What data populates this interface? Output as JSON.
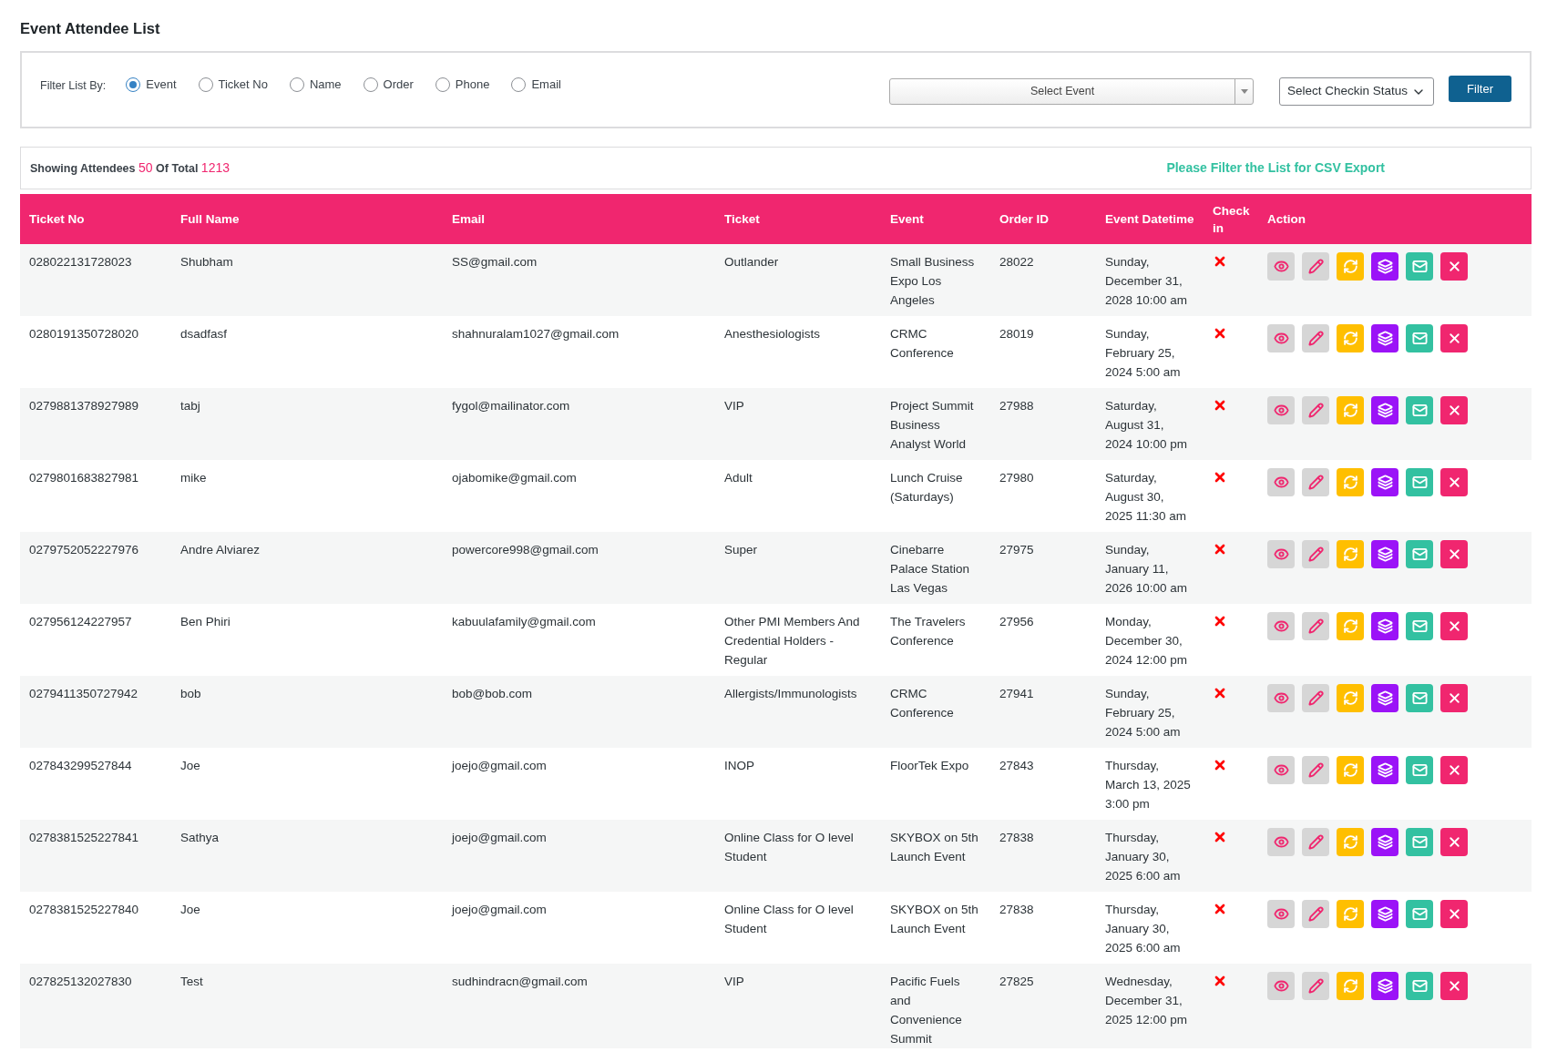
{
  "page_title": "Event Attendee List",
  "filter": {
    "label": "Filter List By:",
    "options": [
      {
        "label": "Event",
        "selected": true
      },
      {
        "label": "Ticket No",
        "selected": false
      },
      {
        "label": "Name",
        "selected": false
      },
      {
        "label": "Order",
        "selected": false
      },
      {
        "label": "Phone",
        "selected": false
      },
      {
        "label": "Email",
        "selected": false
      }
    ],
    "event_select": "Select Event",
    "status_select": "Select Checkin Status",
    "button": "Filter"
  },
  "summary": {
    "prefix": "Showing Attendees",
    "shown": "50",
    "middle": "Of Total",
    "total": "1213",
    "export_note": "Please Filter the List for CSV Export"
  },
  "table": {
    "columns": [
      "Ticket No",
      "Full Name",
      "Email",
      "Ticket",
      "Event",
      "Order ID",
      "Event Datetime",
      "Check in",
      "Action"
    ],
    "rows": [
      {
        "ticket_no": "028022131728023",
        "name": "Shubham",
        "email": "SS@gmail.com",
        "ticket": "Outlander",
        "event": "Small Business Expo Los Angeles",
        "order_id": "28022",
        "datetime": "Sunday, December 31, 2028 10:00 am",
        "checked_in": false
      },
      {
        "ticket_no": "0280191350728020",
        "name": "dsadfasf",
        "email": "shahnuralam1027@gmail.com",
        "ticket": "Anesthesiologists",
        "event": "CRMC Conference",
        "order_id": "28019",
        "datetime": "Sunday, February 25, 2024 5:00 am",
        "checked_in": false
      },
      {
        "ticket_no": "0279881378927989",
        "name": "tabj",
        "email": "fygol@mailinator.com",
        "ticket": "VIP",
        "event": "Project Summit Business Analyst World",
        "order_id": "27988",
        "datetime": "Saturday, August 31, 2024 10:00 pm",
        "checked_in": false
      },
      {
        "ticket_no": "0279801683827981",
        "name": "mike",
        "email": "ojabomike@gmail.com",
        "ticket": "Adult",
        "event": "Lunch Cruise (Saturdays)",
        "order_id": "27980",
        "datetime": "Saturday, August 30, 2025 11:30 am",
        "checked_in": false
      },
      {
        "ticket_no": "0279752052227976",
        "name": "Andre Alviarez",
        "email": "powercore998@gmail.com",
        "ticket": "Super",
        "event": "Cinebarre Palace Station Las Vegas",
        "order_id": "27975",
        "datetime": "Sunday, January 11, 2026 10:00 am",
        "checked_in": false
      },
      {
        "ticket_no": "027956124227957",
        "name": "Ben Phiri",
        "email": "kabuulafamily@gmail.com",
        "ticket": "Other PMI Members And Credential Holders - Regular",
        "event": "The Travelers Conference",
        "order_id": "27956",
        "datetime": "Monday, December 30, 2024 12:00 pm",
        "checked_in": false
      },
      {
        "ticket_no": "0279411350727942",
        "name": "bob",
        "email": "bob@bob.com",
        "ticket": "Allergists/Immunologists",
        "event": "CRMC Conference",
        "order_id": "27941",
        "datetime": "Sunday, February 25, 2024 5:00 am",
        "checked_in": false
      },
      {
        "ticket_no": "027843299527844",
        "name": "Joe",
        "email": "joejo@gmail.com",
        "ticket": "INOP",
        "event": "FloorTek Expo",
        "order_id": "27843",
        "datetime": "Thursday, March 13, 2025 3:00 pm",
        "checked_in": false
      },
      {
        "ticket_no": "0278381525227841",
        "name": "Sathya",
        "email": "joejo@gmail.com",
        "ticket": "Online Class for O level Student",
        "event": "SKYBOX on 5th Launch Event",
        "order_id": "27838",
        "datetime": "Thursday, January 30, 2025 6:00 am",
        "checked_in": false
      },
      {
        "ticket_no": "0278381525227840",
        "name": "Joe",
        "email": "joejo@gmail.com",
        "ticket": "Online Class for O level Student",
        "event": "SKYBOX on 5th Launch Event",
        "order_id": "27838",
        "datetime": "Thursday, January 30, 2025 6:00 am",
        "checked_in": false
      },
      {
        "ticket_no": "027825132027830",
        "name": "Test",
        "email": "sudhindracn@gmail.com",
        "ticket": "VIP",
        "event": "Pacific Fuels and Convenience Summit",
        "order_id": "27825",
        "datetime": "Wednesday, December 31, 2025 12:00 pm",
        "checked_in": false
      }
    ]
  }
}
